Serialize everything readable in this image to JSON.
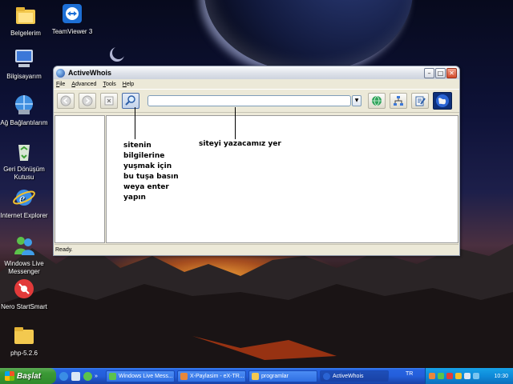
{
  "desktop": {
    "icons": [
      {
        "label": "Belgelerim",
        "icon": "folder-documents-icon"
      },
      {
        "label": "TeamViewer 3",
        "icon": "teamviewer-icon"
      },
      {
        "label": "Bilgisayarım",
        "icon": "computer-icon"
      },
      {
        "label": "Ağ Bağlantılarım",
        "icon": "network-icon"
      },
      {
        "label": "Geri Dönüşüm Kutusu",
        "icon": "recycle-bin-icon"
      },
      {
        "label": "Internet Explorer",
        "icon": "internet-explorer-icon"
      },
      {
        "label": "Windows Live Messenger",
        "icon": "messenger-icon"
      },
      {
        "label": "Nero StartSmart",
        "icon": "nero-icon"
      },
      {
        "label": "php-5.2.6",
        "icon": "folder-icon"
      }
    ]
  },
  "window": {
    "title": "ActiveWhois",
    "menu": [
      "File",
      "Advanced",
      "Tools",
      "Help"
    ],
    "url_value": "",
    "status": "Ready.",
    "annotation_left": [
      "sitenin",
      "bilgilerine",
      "yuşmak için",
      "bu tuşa basın",
      "weya enter",
      "yapın"
    ],
    "annotation_right": "siteyi yazacamız yer",
    "colors": {
      "titlebar": "#dfe3ea",
      "accent": "#2663e0"
    }
  },
  "taskbar": {
    "start_label": "Başlat",
    "tasks": [
      "Windows Live Mess...",
      "X-Paylasim - eX-TR...",
      "programlar",
      "ActiveWhois"
    ],
    "language": "TR",
    "clock": "10:30"
  }
}
